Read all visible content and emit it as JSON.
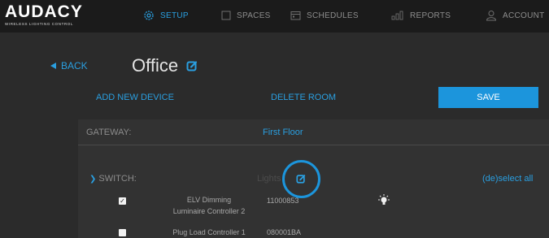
{
  "brand": {
    "name": "AUDACY",
    "tagline": "WIRELESS LIGHTING CONTROL"
  },
  "nav": [
    {
      "label": "SETUP",
      "icon": "gear-icon",
      "active": true
    },
    {
      "label": "SPACES",
      "icon": "spaces-icon",
      "active": false
    },
    {
      "label": "SCHEDULES",
      "icon": "calendar-icon",
      "active": false
    },
    {
      "label": "REPORTS",
      "icon": "bar-chart-icon",
      "active": false
    },
    {
      "label": "ACCOUNT",
      "icon": "user-icon",
      "active": false
    }
  ],
  "header": {
    "back_label": "BACK",
    "room_name": "Office"
  },
  "actions": {
    "add_device": "ADD NEW DEVICE",
    "delete_room": "DELETE ROOM",
    "save": "SAVE"
  },
  "gateway": {
    "label": "GATEWAY:",
    "value": "First Floor"
  },
  "switch_section": {
    "label": "SWITCH:",
    "column_label": "Lights",
    "deselect_label": "(de)select all",
    "devices": [
      {
        "name_line1": "ELV Dimming",
        "name_line2": "Luminaire Controller 2",
        "id": "11000853",
        "checked": true,
        "icon": "light-bulb-icon"
      },
      {
        "name_line1": "Plug Load Controller 1",
        "name_line2": "",
        "id": "080001BA",
        "checked": false,
        "icon": ""
      }
    ]
  },
  "colors": {
    "accent": "#2a9fe0",
    "background": "#2b2b2b",
    "topbar": "#1b1b1b",
    "save_button": "#1c95dc"
  }
}
